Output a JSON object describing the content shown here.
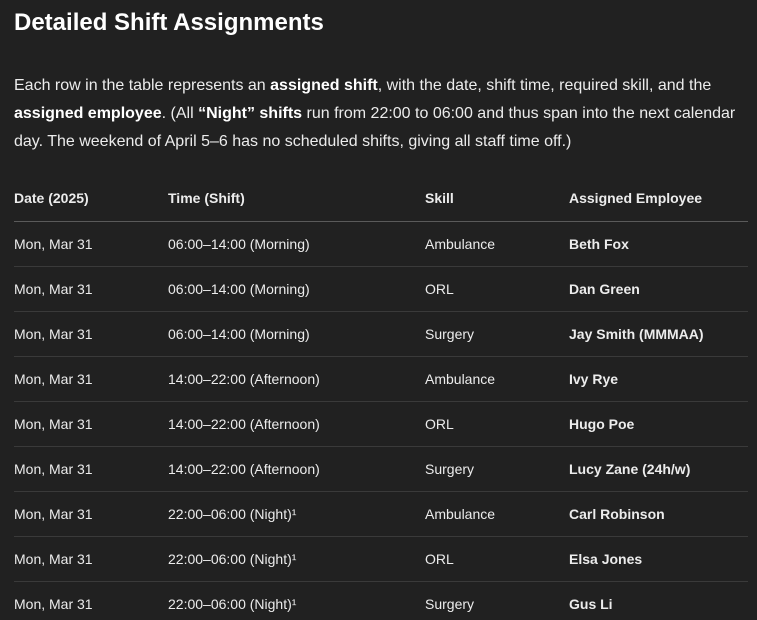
{
  "title": "Detailed Shift Assignments",
  "intro": {
    "t1": "Each row in the table represents an ",
    "b1": "assigned shift",
    "t2": ", with the date, shift time, required skill, and the ",
    "b2": "assigned employee",
    "t3": ". (All ",
    "b3": "“Night” shifts",
    "t4": " run from 22:00 to 06:00 and thus span into the next calendar day. The weekend of April 5–6 has no scheduled shifts, giving all staff time off.)"
  },
  "table": {
    "headers": [
      "Date (2025)",
      "Time (Shift)",
      "Skill",
      "Assigned Employee"
    ],
    "rows": [
      [
        "Mon, Mar 31",
        "06:00–14:00 (Morning)",
        "Ambulance",
        "Beth Fox"
      ],
      [
        "Mon, Mar 31",
        "06:00–14:00 (Morning)",
        "ORL",
        "Dan Green"
      ],
      [
        "Mon, Mar 31",
        "06:00–14:00 (Morning)",
        "Surgery",
        "Jay Smith (MMMAA)"
      ],
      [
        "Mon, Mar 31",
        "14:00–22:00 (Afternoon)",
        "Ambulance",
        "Ivy Rye"
      ],
      [
        "Mon, Mar 31",
        "14:00–22:00 (Afternoon)",
        "ORL",
        "Hugo Poe"
      ],
      [
        "Mon, Mar 31",
        "14:00–22:00 (Afternoon)",
        "Surgery",
        "Lucy Zane (24h/w)"
      ],
      [
        "Mon, Mar 31",
        "22:00–06:00 (Night)¹",
        "Ambulance",
        "Carl Robinson"
      ],
      [
        "Mon, Mar 31",
        "22:00–06:00 (Night)¹",
        "ORL",
        "Elsa Jones"
      ],
      [
        "Mon, Mar 31",
        "22:00–06:00 (Night)¹",
        "Surgery",
        "Gus Li"
      ]
    ]
  }
}
